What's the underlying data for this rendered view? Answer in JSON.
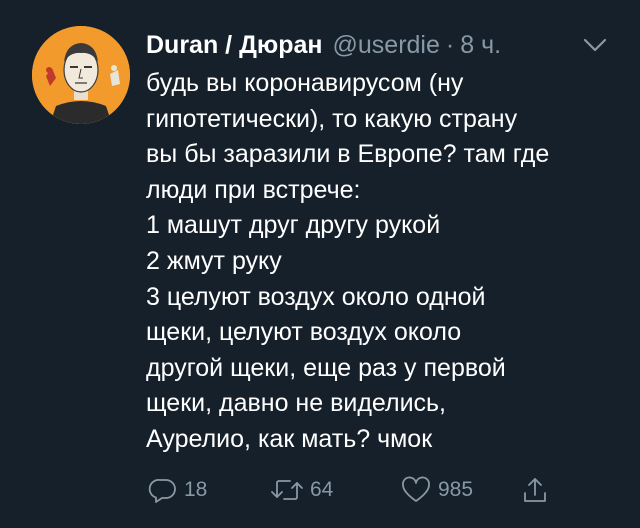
{
  "tweet": {
    "display_name": "Duran / Дюран",
    "handle": "@userdie",
    "separator": "·",
    "time": "8 ч.",
    "lines": [
      "будь вы коронавирусом (ну",
      "гипотетически), то какую страну",
      "вы бы заразили в Европе? там где",
      "люди при встрече:",
      "1 машут друг другу рукой",
      "2 жмут руку",
      "3 целуют воздух около одной",
      "щеки, целуют воздух около",
      "другой щеки, еще раз у первой",
      "щеки, давно не виделись,",
      "Аурелио, как мать? чмок"
    ]
  },
  "actions": {
    "reply_count": "18",
    "retweet_count": "64",
    "like_count": "985"
  },
  "icons": {
    "reply": "reply-icon",
    "retweet": "retweet-icon",
    "like": "heart-icon",
    "share": "share-icon",
    "caret": "chevron-down-icon"
  },
  "colors": {
    "background": "#15202b",
    "text": "#ffffff",
    "secondary": "#8899a6",
    "avatar_bg": "#f39a2c"
  }
}
